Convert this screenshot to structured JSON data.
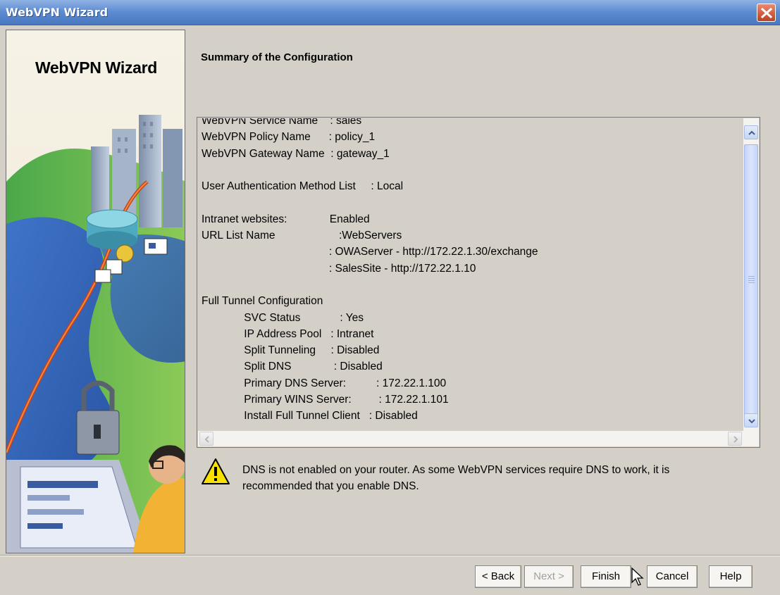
{
  "window": {
    "title": "WebVPN Wizard"
  },
  "side_panel": {
    "title": "WebVPN Wizard"
  },
  "main": {
    "title": "Summary of the Configuration",
    "summary_text": "WebVPN Service Name    : sales\nWebVPN Policy Name      : policy_1\nWebVPN Gateway Name  : gateway_1\n\nUser Authentication Method List     : Local\n\nIntranet websites:              Enabled\nURL List Name                     :WebServers\n                                          : OWAServer - http://172.22.1.30/exchange\n                                          : SalesSite - http://172.22.1.10\n\nFull Tunnel Configuration\n              SVC Status             : Yes\n              IP Address Pool   : Intranet\n              Split Tunneling     : Disabled\n              Split DNS              : Disabled\n              Primary DNS Server:          : 172.22.1.100\n              Primary WINS Server:         : 172.22.1.101\n              Install Full Tunnel Client   : Disabled",
    "warning": {
      "line1": "DNS is not enabled on your router. As some WebVPN services require DNS to work, it is",
      "line2": "recommended that you enable DNS."
    }
  },
  "buttons": {
    "back": "< Back",
    "next": "Next >",
    "finish": "Finish",
    "cancel": "Cancel",
    "help": "Help"
  },
  "colors": {
    "titlebar": "#5b8ad0",
    "dialog_bg": "#d4d0c8",
    "scroll_thumb": "#c4d4f8",
    "warning_yellow": "#f8e000"
  },
  "icons": {
    "close": "close-icon",
    "warning": "warning-icon",
    "scroll_up": "chevron-up-icon",
    "scroll_down": "chevron-down-icon",
    "scroll_left": "chevron-left-icon",
    "scroll_right": "chevron-right-icon",
    "cursor": "mouse-pointer-icon"
  }
}
